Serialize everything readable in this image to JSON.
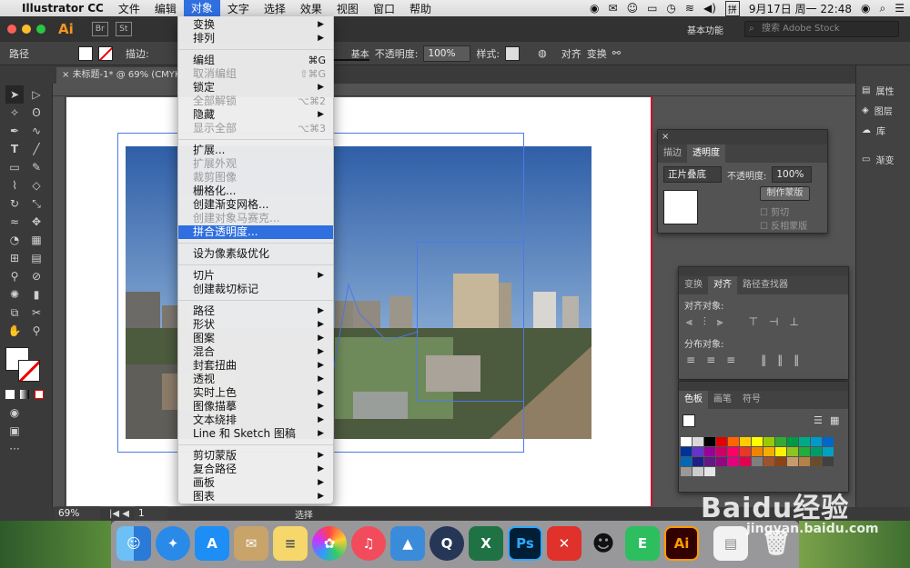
{
  "menubar": {
    "items": [
      "Illustrator CC",
      "文件",
      "编辑",
      "对象",
      "文字",
      "选择",
      "效果",
      "视图",
      "窗口",
      "帮助"
    ],
    "active_index": 3,
    "datetime": "9月17日 周一  22:48",
    "input_method": "拼"
  },
  "appbar": {
    "logo": "Ai",
    "workspace": "基本功能",
    "search_placeholder": "搜索 Adobe Stock"
  },
  "control_bar": {
    "label_path": "路径",
    "stroke_label": "描边:",
    "brush_label": "基本",
    "opacity_label": "不透明度:",
    "opacity_value": "100%",
    "style_label": "样式:",
    "align_label": "对齐",
    "transform_label": "变换"
  },
  "document_tab": "未标题-1* @ 69% (CMYK/GPU",
  "status_bar": {
    "zoom": "69%",
    "page": "1",
    "tool": "选择"
  },
  "object_menu": {
    "items": [
      {
        "label": "变换",
        "submenu": true
      },
      {
        "label": "排列",
        "submenu": true
      },
      {
        "sep": true
      },
      {
        "label": "编组",
        "shortcut": "⌘G"
      },
      {
        "label": "取消编组",
        "shortcut": "⇧⌘G",
        "disabled": true
      },
      {
        "label": "锁定",
        "submenu": true
      },
      {
        "label": "全部解锁",
        "shortcut": "⌥⌘2",
        "disabled": true
      },
      {
        "label": "隐藏",
        "submenu": true
      },
      {
        "label": "显示全部",
        "shortcut": "⌥⌘3",
        "disabled": true
      },
      {
        "sep": true
      },
      {
        "label": "扩展..."
      },
      {
        "label": "扩展外观",
        "disabled": true
      },
      {
        "label": "裁剪图像",
        "disabled": true
      },
      {
        "label": "栅格化..."
      },
      {
        "label": "创建渐变网格..."
      },
      {
        "label": "创建对象马赛克...",
        "disabled": true
      },
      {
        "label": "拼合透明度...",
        "highlighted": true
      },
      {
        "sep": true
      },
      {
        "label": "设为像素级优化"
      },
      {
        "sep": true
      },
      {
        "label": "切片",
        "submenu": true
      },
      {
        "label": "创建裁切标记"
      },
      {
        "sep": true
      },
      {
        "label": "路径",
        "submenu": true
      },
      {
        "label": "形状",
        "submenu": true
      },
      {
        "label": "图案",
        "submenu": true
      },
      {
        "label": "混合",
        "submenu": true
      },
      {
        "label": "封套扭曲",
        "submenu": true
      },
      {
        "label": "透视",
        "submenu": true
      },
      {
        "label": "实时上色",
        "submenu": true
      },
      {
        "label": "图像描摹",
        "submenu": true
      },
      {
        "label": "文本绕排",
        "submenu": true
      },
      {
        "label": "Line 和 Sketch 图稿",
        "submenu": true
      },
      {
        "sep": true
      },
      {
        "label": "剪切蒙版",
        "submenu": true
      },
      {
        "label": "复合路径",
        "submenu": true
      },
      {
        "label": "画板",
        "submenu": true
      },
      {
        "label": "图表",
        "submenu": true
      }
    ]
  },
  "transparency_panel": {
    "tabs": [
      "描边",
      "透明度"
    ],
    "blend_mode": "正片叠底",
    "opacity_label": "不透明度:",
    "opacity_value": "100%",
    "make_mask": "制作蒙版",
    "clip": "剪切",
    "invert_mask": "反相蒙版"
  },
  "align_panel": {
    "tabs": [
      "变换",
      "对齐",
      "路径查找器"
    ],
    "align_objects": "对齐对象:",
    "distribute_objects": "分布对象:"
  },
  "swatches_panel": {
    "tabs": [
      "色板",
      "画笔",
      "符号"
    ],
    "colors": [
      "#ffffff",
      "#d9d9d9",
      "#000000",
      "#e10000",
      "#ff6600",
      "#ffcc00",
      "#ffff00",
      "#99cc00",
      "#33aa33",
      "#009944",
      "#00aa88",
      "#0099cc",
      "#0066cc",
      "#003399",
      "#6633cc",
      "#990099",
      "#cc0066",
      "#ff0066",
      "#e83828",
      "#f08300",
      "#f6ad00",
      "#fff100",
      "#8fc31f",
      "#22ac38",
      "#009b6b",
      "#00a0c1",
      "#0068b7",
      "#1d2088",
      "#601986",
      "#920783",
      "#e4007f",
      "#e5004f",
      "#7f7f7f",
      "#a0522d",
      "#8b4513",
      "#c89b6d",
      "#b28247",
      "#6b4c2a",
      "#404040",
      "#999999",
      "#cccccc",
      "#e6e6e6"
    ]
  },
  "right_dock": {
    "items": [
      "属性",
      "图层",
      "库",
      "渐变"
    ]
  },
  "watermark": {
    "logo": "Baidu经验",
    "url": "jingyan.baidu.com"
  }
}
